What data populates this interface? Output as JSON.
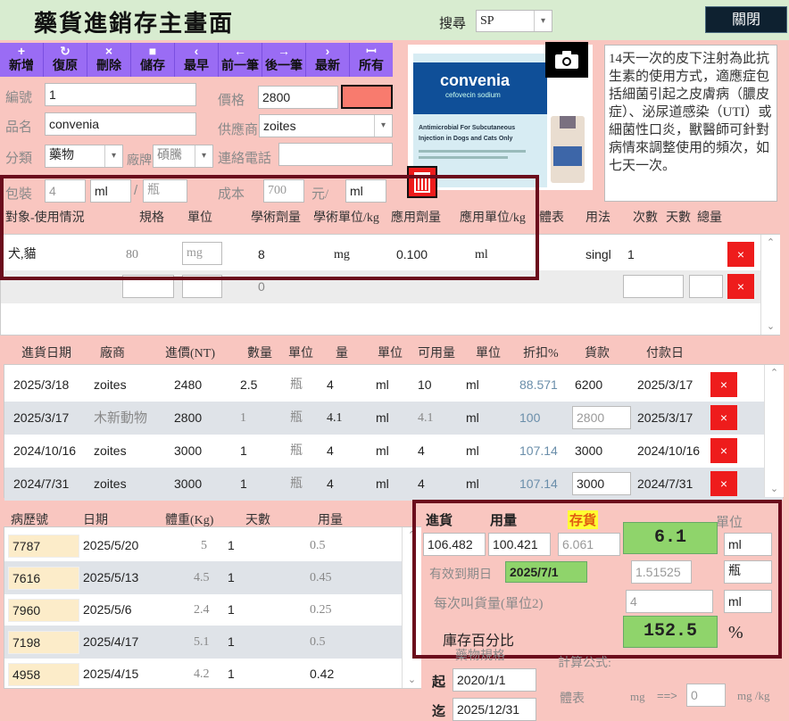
{
  "title": "藥貨進銷存主畫面",
  "search": {
    "label": "搜尋",
    "value": "SP"
  },
  "close_label": "關閉",
  "toolbar": [
    {
      "icon": "+",
      "label": "新增",
      "name": "add"
    },
    {
      "icon": "↻",
      "label": "復原",
      "name": "restore"
    },
    {
      "icon": "×",
      "label": "刪除",
      "name": "delete"
    },
    {
      "icon": "■",
      "label": "儲存",
      "name": "save"
    },
    {
      "icon": "‹",
      "label": "最早",
      "name": "first"
    },
    {
      "icon": "←",
      "label": "前一筆",
      "name": "prev"
    },
    {
      "icon": "→",
      "label": "後一筆",
      "name": "next"
    },
    {
      "icon": "›",
      "label": "最新",
      "name": "last"
    },
    {
      "icon": "ꟷ",
      "label": "所有",
      "name": "all"
    }
  ],
  "form": {
    "id_label": "編號",
    "id": "1",
    "name_label": "品名",
    "name": "convenia",
    "category_label": "分類",
    "category": "藥物",
    "brand_label": "廠牌",
    "brand": "碩騰",
    "price_label": "價格",
    "price": "2800",
    "supplier_label": "供應商",
    "supplier": "zoites",
    "phone_label": "連絡電話",
    "phone": "",
    "pack_label": "包裝",
    "pack_qty": "4",
    "pack_unit": "ml",
    "slash": "/",
    "pack_container": "瓶",
    "cost_label": "成本",
    "cost": "700",
    "cost_unit": "元/",
    "cost_per": "ml"
  },
  "photo": {
    "brand": "convenia",
    "sub": "cefovecin sodium",
    "line1": "Antimicrobial For Subcutaneous",
    "line2": "Injection in Dogs and Cats Only"
  },
  "description": "14天一次的皮下注射為此抗生素的使用方式，適應症包括細菌引起之皮膚病（膿皮症）、泌尿道感染（UTI）或細菌性口炎，獸醫師可針對病情來調整使用的頻次，如七天一次。",
  "usage": {
    "headers": [
      "對象-使用情況",
      "規格",
      "單位",
      "學術劑量",
      "學術單位/kg",
      "應用劑量",
      "應用單位/kg",
      "體表",
      "用法",
      "次數",
      "天數",
      "總量"
    ],
    "rows": [
      {
        "target": "犬,貓",
        "spec": "80",
        "unit": "mg",
        "dose": "8",
        "dose_unit": "mg",
        "apply": "0.100",
        "apply_unit": "ml",
        "method": "singl",
        "times": "1"
      },
      {
        "target": "",
        "spec": "",
        "unit": "",
        "dose": "0",
        "dose_unit": "",
        "apply": "",
        "apply_unit": "",
        "method": "",
        "times": ""
      }
    ]
  },
  "purchase": {
    "headers": [
      "進貨日期",
      "廠商",
      "進價(NT)",
      "數量",
      "單位",
      "量",
      "單位",
      "可用量",
      "單位",
      "折扣%",
      "貨款",
      "付款日"
    ],
    "rows": [
      {
        "date": "2025/3/18",
        "vendor": "zoites",
        "price": "2480",
        "qty": "2.5",
        "unit": "瓶",
        "amount": "4",
        "unit2": "ml",
        "avail": "10",
        "unit3": "ml",
        "discount": "88.571",
        "payment": "6200",
        "paydate": "2025/3/17"
      },
      {
        "date": "2025/3/17",
        "vendor": "木新動物",
        "price": "2800",
        "qty": "1",
        "unit": "瓶",
        "amount": "4.1",
        "unit2": "ml",
        "avail": "4.1",
        "unit3": "ml",
        "discount": "100",
        "payment": "2800",
        "paydate": "2025/3/17"
      },
      {
        "date": "2024/10/16",
        "vendor": "zoites",
        "price": "3000",
        "qty": "1",
        "unit": "瓶",
        "amount": "4",
        "unit2": "ml",
        "avail": "4",
        "unit3": "ml",
        "discount": "107.14",
        "payment": "3000",
        "paydate": "2024/10/16"
      },
      {
        "date": "2024/7/31",
        "vendor": "zoites",
        "price": "3000",
        "qty": "1",
        "unit": "瓶",
        "amount": "4",
        "unit2": "ml",
        "avail": "4",
        "unit3": "ml",
        "discount": "107.14",
        "payment": "3000",
        "paydate": "2024/7/31"
      }
    ]
  },
  "history": {
    "headers": [
      "病歷號",
      "日期",
      "體重(Kg)",
      "天數",
      "用量"
    ],
    "rows": [
      {
        "id": "7787",
        "date": "2025/5/20",
        "weight": "5",
        "days": "1",
        "dose": "0.5"
      },
      {
        "id": "7616",
        "date": "2025/5/13",
        "weight": "4.5",
        "days": "1",
        "dose": "0.45"
      },
      {
        "id": "7960",
        "date": "2025/5/6",
        "weight": "2.4",
        "days": "1",
        "dose": "0.25"
      },
      {
        "id": "7198",
        "date": "2025/4/17",
        "weight": "5.1",
        "days": "1",
        "dose": "0.5"
      },
      {
        "id": "4958",
        "date": "2025/4/15",
        "weight": "4.2",
        "days": "1",
        "dose": "0.42"
      }
    ]
  },
  "stock": {
    "in_label": "進貨",
    "use_label": "用量",
    "stock_label": "存貨",
    "unit_label": "單位",
    "in_value": "106.482",
    "use_value": "100.421",
    "stock_value": "6.061",
    "stock_big": "6.1",
    "unit": "ml",
    "expiry_label": "有效到期日",
    "expiry": "2025/7/1",
    "ratio": "1.51525",
    "ratio_unit": "瓶",
    "reorder_label": "每次叫貨量(單位2)",
    "reorder": "4",
    "reorder_unit": "ml",
    "percent_label": "庫存百分比",
    "percent": "152.5",
    "percent_sign": "%"
  },
  "footer": {
    "spec_label": "藥物規格",
    "formula_label": "計算公式:",
    "from_label": "起",
    "from": "2020/1/1",
    "to_label": "迄",
    "to": "2025/12/31",
    "surface_label": "體表",
    "mg_label": "mg",
    "arrow": "==>",
    "result": "0",
    "result_unit": "mg /kg"
  }
}
